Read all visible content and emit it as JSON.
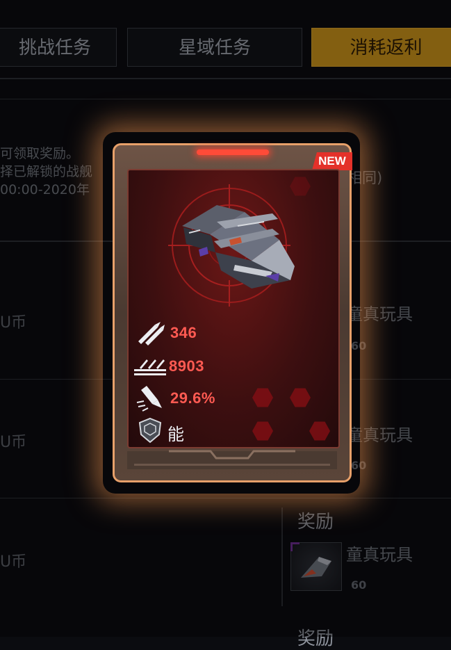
{
  "tabs": [
    {
      "label": "挑战任务",
      "active": false
    },
    {
      "label": "星域任务",
      "active": false
    },
    {
      "label": "消耗返利",
      "active": true
    }
  ],
  "background": {
    "desc_lines": [
      "可领取奖励。",
      "择已解锁的战舰",
      "00:00-2020年"
    ],
    "desc_right": "相同)",
    "coin_label": "U币",
    "rewards": [
      {
        "name": "童真玩具",
        "count": "60"
      },
      {
        "name": "童真玩具",
        "count": "60"
      },
      {
        "title": "奖励",
        "name": "童真玩具",
        "count": "60"
      }
    ],
    "reward_title_partial": "奖励"
  },
  "card": {
    "badge": "NEW",
    "stats": [
      {
        "icon": "missile-attack-icon",
        "value": "346"
      },
      {
        "icon": "barrage-icon",
        "value": "8903"
      },
      {
        "icon": "rocket-crit-icon",
        "value": "29.6%"
      }
    ],
    "skill": {
      "icon": "shield-icon",
      "label": "能量盾"
    }
  },
  "colors": {
    "accent": "#c9931b",
    "stat_red": "#ff5a52",
    "card_glow": "#e7a06a",
    "badge": "#e4312a"
  }
}
